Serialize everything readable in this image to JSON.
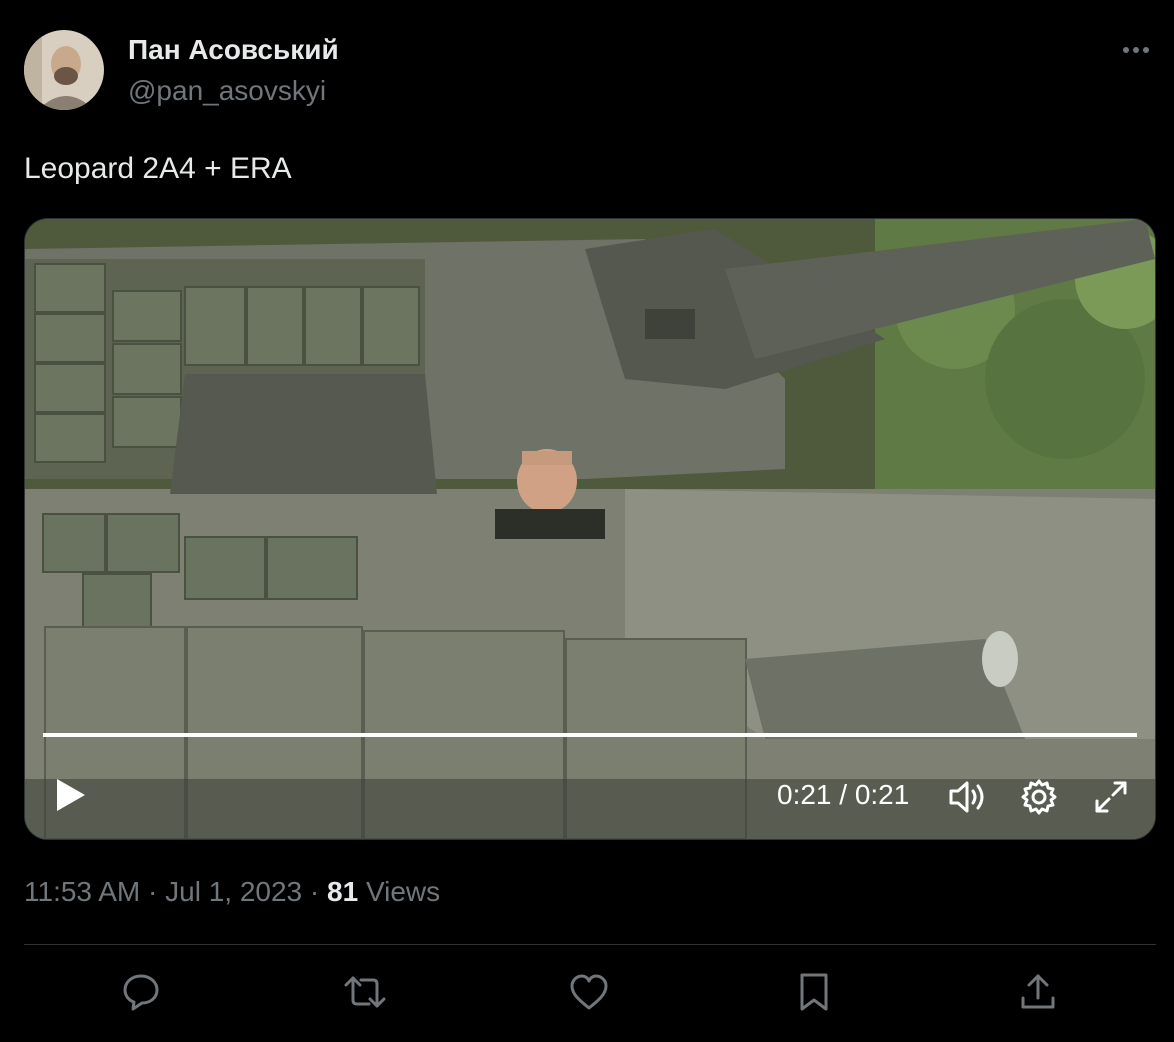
{
  "author": {
    "display_name": "Пан Асовський",
    "handle": "@pan_asovskyi"
  },
  "tweet": {
    "text": "Leopard 2A4 + ERA"
  },
  "video": {
    "time_display": "0:21 / 0:21",
    "progress": 1.0
  },
  "meta": {
    "time": "11:53 AM",
    "sep1": " · ",
    "date": "Jul 1, 2023",
    "sep2": " · ",
    "views_count": "81",
    "views_label": " Views"
  },
  "icons": {
    "more": "more-icon",
    "play": "play-icon",
    "volume": "volume-icon",
    "settings": "gear-icon",
    "fullscreen": "fullscreen-icon",
    "reply": "reply-icon",
    "retweet": "retweet-icon",
    "like": "heart-icon",
    "bookmark": "bookmark-icon",
    "share": "share-icon"
  },
  "colors": {
    "background": "#000000",
    "text": "#e7e9ea",
    "secondary": "#71767b",
    "divider": "#2f3336"
  }
}
